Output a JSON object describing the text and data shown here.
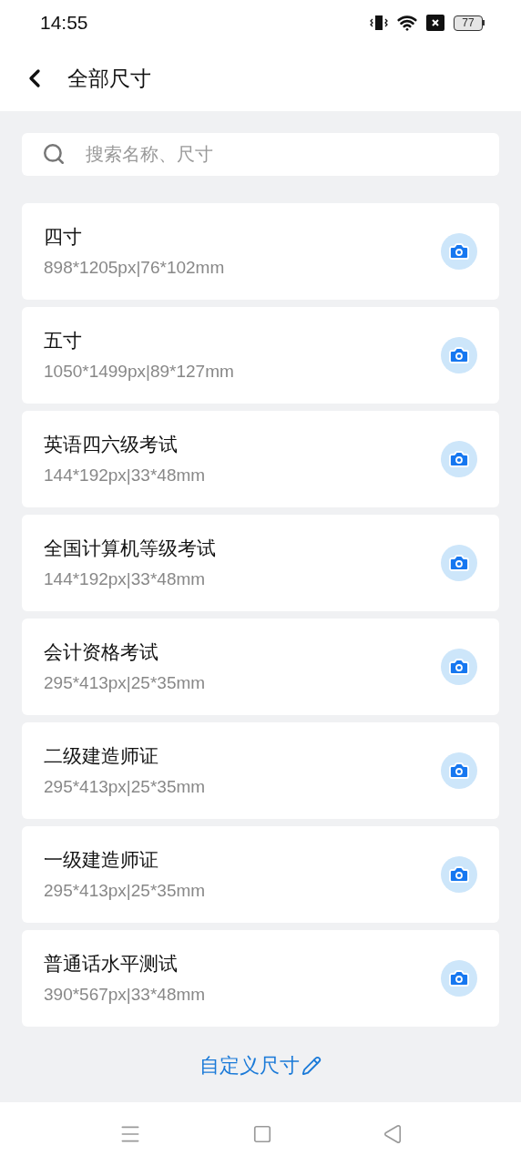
{
  "status_bar": {
    "time": "14:55",
    "battery": "77"
  },
  "header": {
    "title": "全部尺寸"
  },
  "search": {
    "placeholder": "搜索名称、尺寸"
  },
  "sizes": [
    {
      "name": "四寸",
      "spec": "898*1205px|76*102mm"
    },
    {
      "name": "五寸",
      "spec": "1050*1499px|89*127mm"
    },
    {
      "name": "英语四六级考试",
      "spec": "144*192px|33*48mm"
    },
    {
      "name": "全国计算机等级考试",
      "spec": "144*192px|33*48mm"
    },
    {
      "name": "会计资格考试",
      "spec": "295*413px|25*35mm"
    },
    {
      "name": "二级建造师证",
      "spec": "295*413px|25*35mm"
    },
    {
      "name": "一级建造师证",
      "spec": "295*413px|25*35mm"
    },
    {
      "name": "普通话水平测试",
      "spec": "390*567px|33*48mm"
    }
  ],
  "custom_link": "自定义尺寸"
}
